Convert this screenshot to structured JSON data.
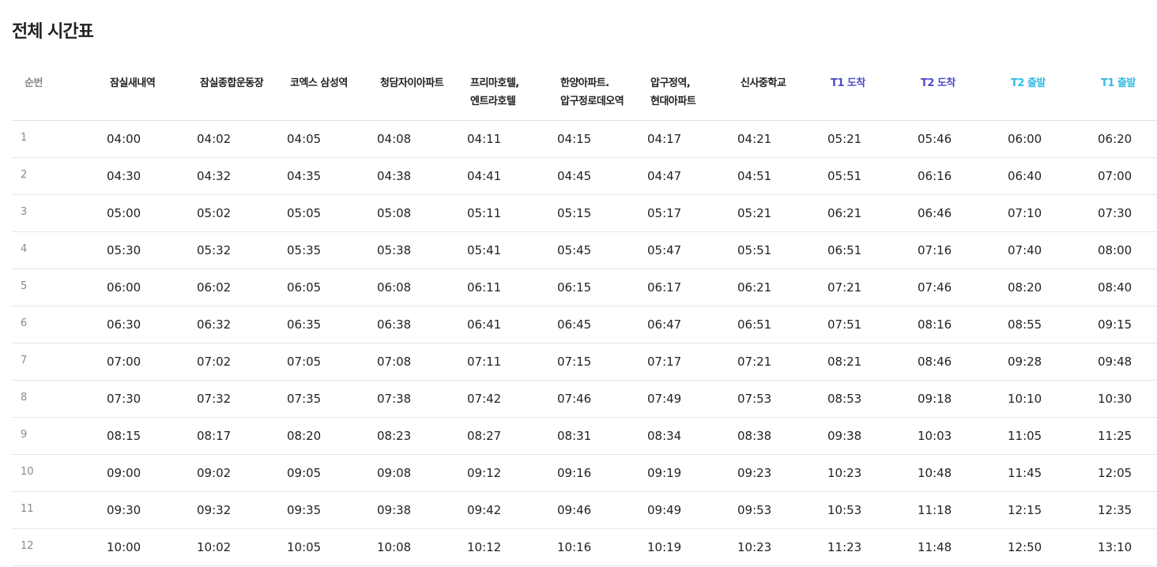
{
  "page": {
    "title": "전체 시간표"
  },
  "table": {
    "headers": [
      "순번",
      "잠실새내역",
      "잠실종합운동장",
      "코엑스 삼성역",
      "청담자이아파트",
      "프리마호텔, 엔트라호텔",
      "한양아파트.압구정로데오역",
      "압구정역, 현대아파트",
      "신사중학교",
      "T1 도착",
      "T2 도착",
      "T2 출발",
      "T1 출발"
    ],
    "header_colors": {
      "number": "#888888",
      "stop": "#222222",
      "arrival": "#4b4bcc",
      "departure": "#33bbe6"
    },
    "rows": [
      [
        "1",
        "04:00",
        "04:02",
        "04:05",
        "04:08",
        "04:11",
        "04:15",
        "04:17",
        "04:21",
        "05:21",
        "05:46",
        "06:00",
        "06:20"
      ],
      [
        "2",
        "04:30",
        "04:32",
        "04:35",
        "04:38",
        "04:41",
        "04:45",
        "04:47",
        "04:51",
        "05:51",
        "06:16",
        "06:40",
        "07:00"
      ],
      [
        "3",
        "05:00",
        "05:02",
        "05:05",
        "05:08",
        "05:11",
        "05:15",
        "05:17",
        "05:21",
        "06:21",
        "06:46",
        "07:10",
        "07:30"
      ],
      [
        "4",
        "05:30",
        "05:32",
        "05:35",
        "05:38",
        "05:41",
        "05:45",
        "05:47",
        "05:51",
        "06:51",
        "07:16",
        "07:40",
        "08:00"
      ],
      [
        "5",
        "06:00",
        "06:02",
        "06:05",
        "06:08",
        "06:11",
        "06:15",
        "06:17",
        "06:21",
        "07:21",
        "07:46",
        "08:20",
        "08:40"
      ],
      [
        "6",
        "06:30",
        "06:32",
        "06:35",
        "06:38",
        "06:41",
        "06:45",
        "06:47",
        "06:51",
        "07:51",
        "08:16",
        "08:55",
        "09:15"
      ],
      [
        "7",
        "07:00",
        "07:02",
        "07:05",
        "07:08",
        "07:11",
        "07:15",
        "07:17",
        "07:21",
        "08:21",
        "08:46",
        "09:28",
        "09:48"
      ],
      [
        "8",
        "07:30",
        "07:32",
        "07:35",
        "07:38",
        "07:42",
        "07:46",
        "07:49",
        "07:53",
        "08:53",
        "09:18",
        "10:10",
        "10:30"
      ],
      [
        "9",
        "08:15",
        "08:17",
        "08:20",
        "08:23",
        "08:27",
        "08:31",
        "08:34",
        "08:38",
        "09:38",
        "10:03",
        "11:05",
        "11:25"
      ],
      [
        "10",
        "09:00",
        "09:02",
        "09:05",
        "09:08",
        "09:12",
        "09:16",
        "09:19",
        "09:23",
        "10:23",
        "10:48",
        "11:45",
        "12:05"
      ],
      [
        "11",
        "09:30",
        "09:32",
        "09:35",
        "09:38",
        "09:42",
        "09:46",
        "09:49",
        "09:53",
        "10:53",
        "11:18",
        "12:15",
        "12:35"
      ],
      [
        "12",
        "10:00",
        "10:02",
        "10:05",
        "10:08",
        "10:12",
        "10:16",
        "10:19",
        "10:23",
        "11:23",
        "11:48",
        "12:50",
        "13:10"
      ]
    ]
  }
}
